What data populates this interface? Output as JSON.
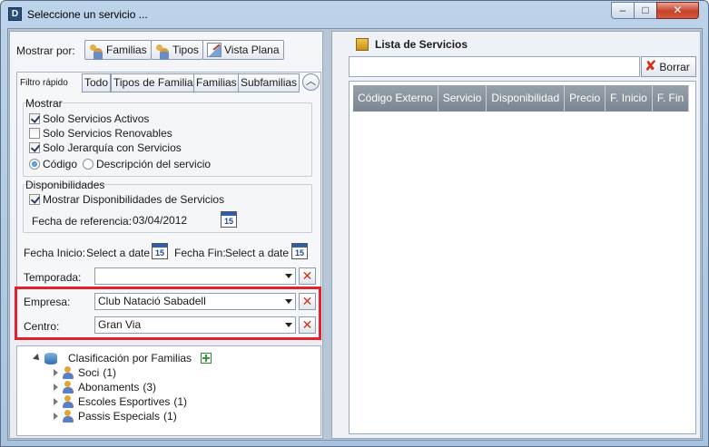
{
  "window": {
    "title": "Seleccione un servicio ...",
    "app_icon": "D",
    "controls": {
      "minimize": "–",
      "maximize": "□",
      "close": "✕"
    }
  },
  "left": {
    "mostrar_por": {
      "label": "Mostrar por:",
      "buttons": [
        "Familias",
        "Tipos",
        "Vista Plana"
      ]
    },
    "filter_tabs": {
      "caption": "Filtro rápido",
      "tabs": [
        "Todo",
        "Tipos de Familia",
        "Familias",
        "Subfamilias"
      ]
    },
    "mostrar": {
      "legend": "Mostrar",
      "options": [
        {
          "label": "Solo Servicios Activos",
          "checked": true
        },
        {
          "label": "Solo Servicios Renovables",
          "checked": false
        },
        {
          "label": "Solo Jerarquía con Servicios",
          "checked": true
        }
      ],
      "radio": [
        {
          "label": "Código",
          "checked": true
        },
        {
          "label": "Descripción del servicio",
          "checked": false
        }
      ]
    },
    "disponibilidades": {
      "legend": "Disponibilidades",
      "option": {
        "label": "Mostrar Disponibilidades de Servicios",
        "checked": true
      },
      "fecha_ref_label": "Fecha de referencia:",
      "fecha_ref_value": "03/04/2012"
    },
    "fechas": {
      "inicio_label": "Fecha Inicio:",
      "inicio_value": "Select a date",
      "fin_label": "Fecha Fin:",
      "fin_value": "Select a date",
      "calendar_day": "15"
    },
    "temporada": {
      "label": "Temporada:",
      "value": ""
    },
    "empresa": {
      "label": "Empresa:",
      "value": "Club Natació Sabadell"
    },
    "centro": {
      "label": "Centro:",
      "value": "Gran Via"
    },
    "tree": {
      "root": "Clasificación por Familias",
      "items": [
        {
          "label": "Soci",
          "count": "(1)"
        },
        {
          "label": "Abonaments",
          "count": "(3)"
        },
        {
          "label": "Escoles Esportives",
          "count": "(1)"
        },
        {
          "label": "Passis Especials",
          "count": "(1)"
        }
      ]
    }
  },
  "right": {
    "title": "Lista de Servicios",
    "search_value": "",
    "clear_label": "Borrar",
    "columns": [
      "Código Externo",
      "Servicio",
      "Disponibilidad",
      "Precio",
      "F. Inicio",
      "F. Fin"
    ]
  },
  "colors": {
    "highlight": "#e0232a",
    "grid_header": "#8a939d",
    "clear_red": "#d0311b"
  }
}
